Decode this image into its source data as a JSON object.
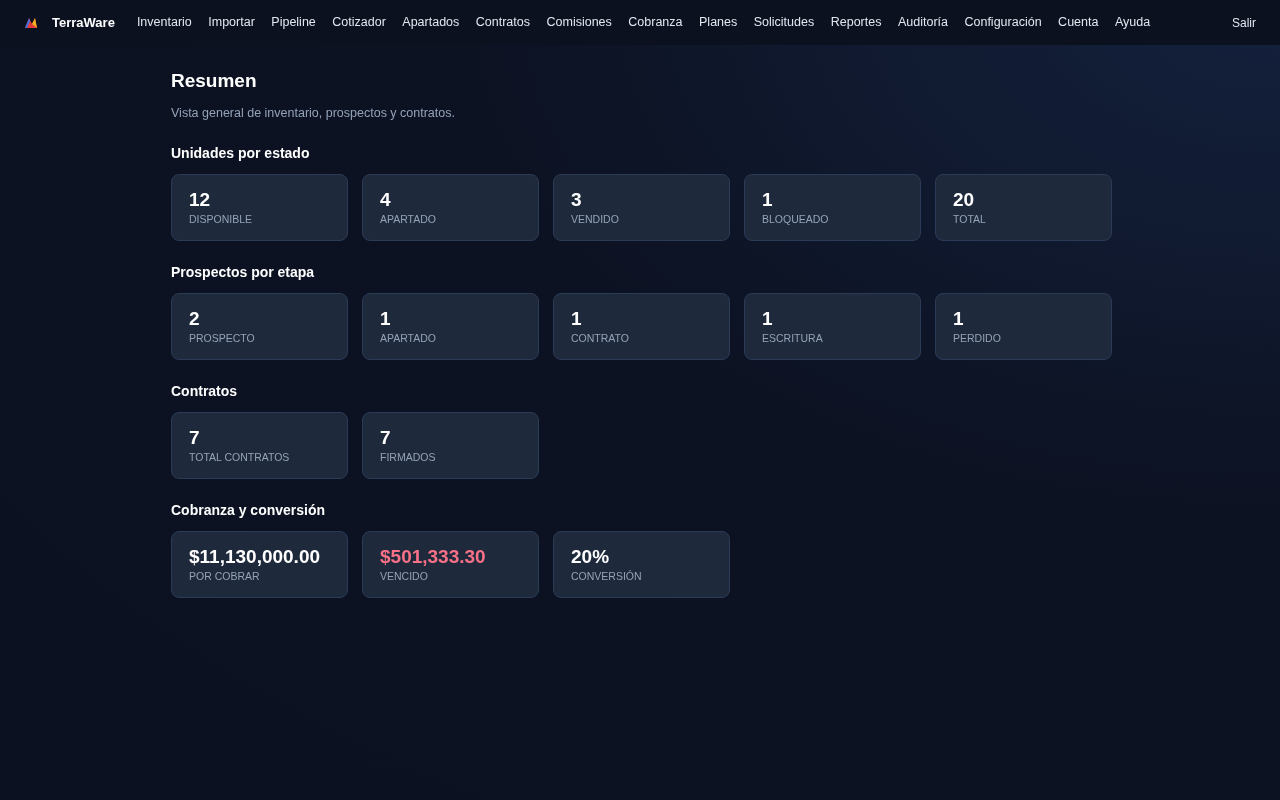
{
  "brand": "TerraWare",
  "nav": [
    "Inventario",
    "Importar",
    "Pipeline",
    "Cotizador",
    "Apartados",
    "Contratos",
    "Comisiones",
    "Cobranza",
    "Planes",
    "Solicitudes",
    "Reportes",
    "Auditoría",
    "Configuración",
    "Cuenta",
    "Ayuda"
  ],
  "logout": "Salir",
  "title": "Resumen",
  "subtitle": "Vista general de inventario, prospectos y contratos.",
  "sections": [
    {
      "heading": "Unidades por estado",
      "cards": [
        {
          "value": "12",
          "label": "DISPONIBLE",
          "alert": false
        },
        {
          "value": "4",
          "label": "APARTADO",
          "alert": false
        },
        {
          "value": "3",
          "label": "VENDIDO",
          "alert": false
        },
        {
          "value": "1",
          "label": "BLOQUEADO",
          "alert": false
        },
        {
          "value": "20",
          "label": "TOTAL",
          "alert": false
        }
      ]
    },
    {
      "heading": "Prospectos por etapa",
      "cards": [
        {
          "value": "2",
          "label": "PROSPECTO",
          "alert": false
        },
        {
          "value": "1",
          "label": "APARTADO",
          "alert": false
        },
        {
          "value": "1",
          "label": "CONTRATO",
          "alert": false
        },
        {
          "value": "1",
          "label": "ESCRITURA",
          "alert": false
        },
        {
          "value": "1",
          "label": "PERDIDO",
          "alert": false
        }
      ]
    },
    {
      "heading": "Contratos",
      "cards": [
        {
          "value": "7",
          "label": "TOTAL CONTRATOS",
          "alert": false
        },
        {
          "value": "7",
          "label": "FIRMADOS",
          "alert": false
        }
      ]
    },
    {
      "heading": "Cobranza y conversión",
      "cards": [
        {
          "value": "$11,130,000.00",
          "label": "POR COBRAR",
          "alert": false
        },
        {
          "value": "$501,333.30",
          "label": "VENCIDO",
          "alert": true
        },
        {
          "value": "20%",
          "label": "CONVERSIÓN",
          "alert": false
        }
      ]
    }
  ]
}
